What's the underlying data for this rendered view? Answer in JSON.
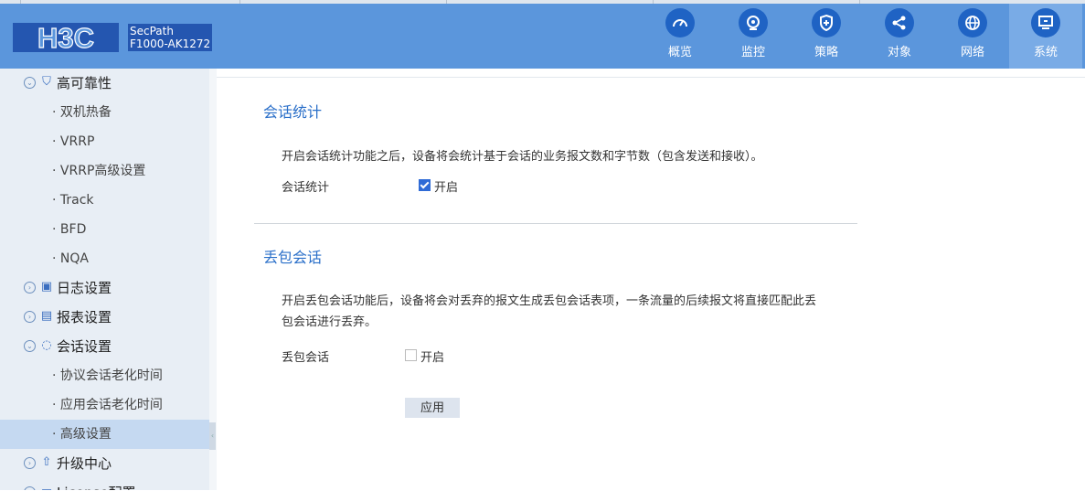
{
  "header": {
    "logo_text": "H3C",
    "product_name": "SecPath",
    "product_model": "F1000-AK1272",
    "nav": [
      {
        "label": "概览",
        "icon": "dashboard-icon"
      },
      {
        "label": "监控",
        "icon": "monitor-icon"
      },
      {
        "label": "策略",
        "icon": "shield-icon"
      },
      {
        "label": "对象",
        "icon": "share-icon"
      },
      {
        "label": "网络",
        "icon": "globe-icon"
      },
      {
        "label": "系统",
        "icon": "computer-icon",
        "active": true
      }
    ]
  },
  "sidebar": {
    "items": [
      {
        "label": "高可靠性",
        "level": 1,
        "icon": "shield-icon"
      },
      {
        "label": "双机热备",
        "level": 2
      },
      {
        "label": "VRRP",
        "level": 2
      },
      {
        "label": "VRRP高级设置",
        "level": 2
      },
      {
        "label": "Track",
        "level": 2
      },
      {
        "label": "BFD",
        "level": 2
      },
      {
        "label": "NQA",
        "level": 2
      },
      {
        "label": "日志设置",
        "level": 1,
        "icon": "log-icon"
      },
      {
        "label": "报表设置",
        "level": 1,
        "icon": "report-icon"
      },
      {
        "label": "会话设置",
        "level": 1,
        "icon": "session-icon"
      },
      {
        "label": "协议会话老化时间",
        "level": 2
      },
      {
        "label": "应用会话老化时间",
        "level": 2
      },
      {
        "label": "高级设置",
        "level": 2,
        "selected": true
      },
      {
        "label": "升级中心",
        "level": 1,
        "icon": "upload-icon"
      },
      {
        "label": "License配置",
        "level": 1,
        "icon": "license-icon"
      }
    ]
  },
  "main": {
    "session_stats": {
      "title": "会话统计",
      "description": "开启会话统计功能之后，设备将会统计基于会话的业务报文数和字节数（包含发送和接收）。",
      "field_label": "会话统计",
      "checkbox_label": "开启",
      "checked": true
    },
    "drop_session": {
      "title": "丢包会话",
      "description_line1": "开启丢包会话功能后，设备将会对丢弃的报文生成丢包会话表项，一条流量的后续报文将直接匹配此丢",
      "description_line2": "包会话进行丢弃。",
      "field_label": "丢包会话",
      "checkbox_label": "开启",
      "checked": false
    },
    "apply_label": "应用"
  },
  "colors": {
    "header": "#5b96dc",
    "accent": "#2a6fc9",
    "sidebar_bg": "#e8eef5",
    "selected": "#c5d9f1"
  }
}
